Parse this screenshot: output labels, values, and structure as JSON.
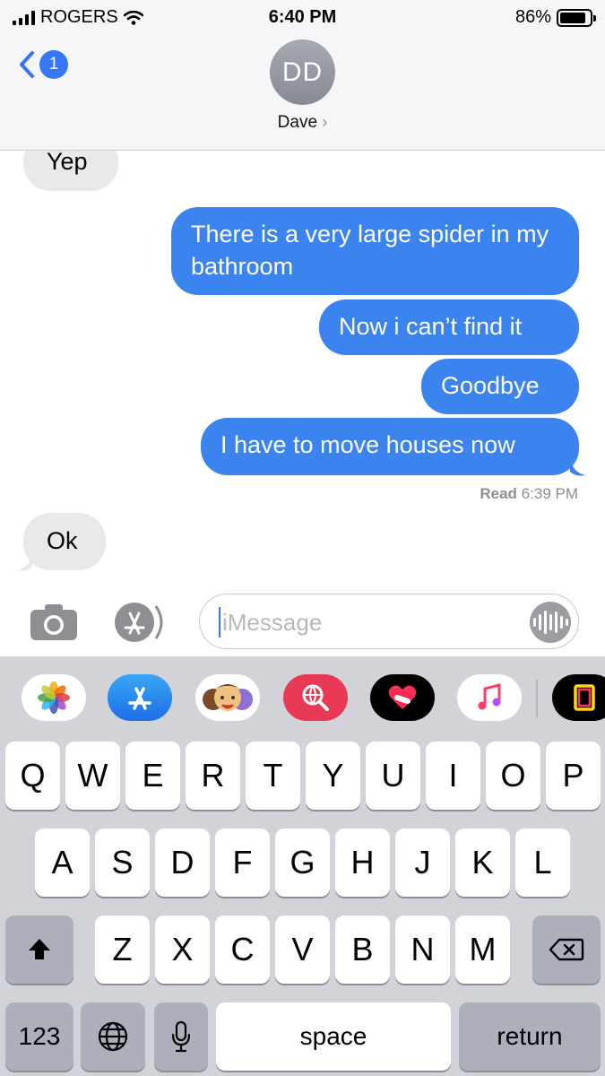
{
  "status": {
    "carrier": "ROGERS",
    "time": "6:40 PM",
    "battery": "86%",
    "battery_level": 0.86
  },
  "header": {
    "back_badge": "1",
    "avatar_initials": "DD",
    "contact_name": "Dave",
    "contact_chevron": "›"
  },
  "messages": [
    {
      "from": "contact",
      "text": "Yep"
    },
    {
      "from": "me",
      "text": "There is a very large spider in my bathroom"
    },
    {
      "from": "me",
      "text": "Now i can’t find it"
    },
    {
      "from": "me",
      "text": "Goodbye"
    },
    {
      "from": "me",
      "text": "I have to move houses now"
    },
    {
      "from": "contact",
      "text": "Ok"
    }
  ],
  "receipt": {
    "label": "Read",
    "time": "6:39 PM"
  },
  "compose": {
    "placeholder": "iMessage"
  },
  "app_strip": [
    "photos-icon",
    "app-store-icon",
    "memoji-icon",
    "web-search-icon",
    "digital-touch-icon",
    "music-icon",
    "extension-app-icon"
  ],
  "keyboard": {
    "row1": [
      "Q",
      "W",
      "E",
      "R",
      "T",
      "Y",
      "U",
      "I",
      "O",
      "P"
    ],
    "row2": [
      "A",
      "S",
      "D",
      "F",
      "G",
      "H",
      "J",
      "K",
      "L"
    ],
    "row3": [
      "Z",
      "X",
      "C",
      "V",
      "B",
      "N",
      "M"
    ],
    "numbers": "123",
    "space": "space",
    "return": "return"
  },
  "colors": {
    "sent_bubble": "#3b84f0",
    "received_bubble": "#e9e9eb",
    "accent": "#3478f6",
    "keyboard_bg": "#d1d3d9"
  }
}
